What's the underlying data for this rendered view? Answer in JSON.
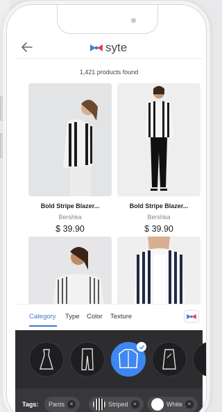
{
  "header": {
    "brand": "syte"
  },
  "results": {
    "count_text": "1,421 products found"
  },
  "products": [
    {
      "name": "Bold Stripe Blazer...",
      "brand": "Bershka",
      "price": "$ 39.90"
    },
    {
      "name": "Bold Stripe Blazer...",
      "brand": "Bershka",
      "price": "$ 39.90"
    }
  ],
  "filters": {
    "tabs": [
      {
        "label": "Category",
        "active": true
      },
      {
        "label": "Type",
        "active": false
      },
      {
        "label": "Color",
        "active": false
      },
      {
        "label": "Texture",
        "active": false
      }
    ],
    "categories": [
      "dress",
      "pants",
      "jacket",
      "skirt"
    ],
    "selected_category": "jacket"
  },
  "tags": {
    "label": "Tags:",
    "items": [
      "Pants",
      "Striped",
      "White"
    ]
  },
  "colors": {
    "accent": "#3a78d6",
    "dark_bar": "#2d2d30",
    "tag_bar": "#38383c"
  }
}
